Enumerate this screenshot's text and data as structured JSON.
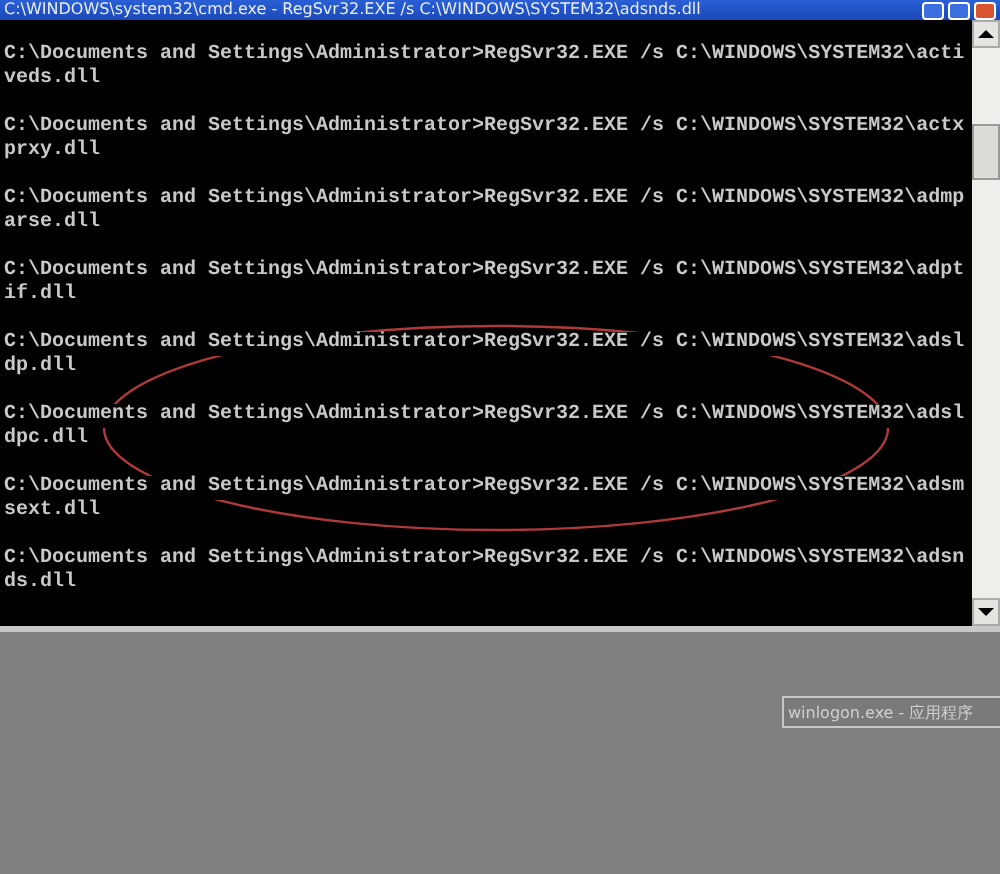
{
  "window": {
    "title": "C:\\WINDOWS\\system32\\cmd.exe - RegSvr32.EXE /s C:\\WINDOWS\\SYSTEM32\\adsnds.dll"
  },
  "console": {
    "entries": [
      {
        "command": "C:\\Documents and Settings\\Administrator>RegSvr32.EXE /s C:\\WINDOWS\\SYSTEM32\\acti",
        "continuation": "veds.dll"
      },
      {
        "command": "C:\\Documents and Settings\\Administrator>RegSvr32.EXE /s C:\\WINDOWS\\SYSTEM32\\actx",
        "continuation": "prxy.dll"
      },
      {
        "command": "C:\\Documents and Settings\\Administrator>RegSvr32.EXE /s C:\\WINDOWS\\SYSTEM32\\admp",
        "continuation": "arse.dll"
      },
      {
        "command": "C:\\Documents and Settings\\Administrator>RegSvr32.EXE /s C:\\WINDOWS\\SYSTEM32\\adpt",
        "continuation": "if.dll"
      },
      {
        "command": "C:\\Documents and Settings\\Administrator>RegSvr32.EXE /s C:\\WINDOWS\\SYSTEM32\\adsl",
        "continuation": "dp.dll"
      },
      {
        "command": "C:\\Documents and Settings\\Administrator>RegSvr32.EXE /s C:\\WINDOWS\\SYSTEM32\\adsl",
        "continuation": "dpc.dll"
      },
      {
        "command": "C:\\Documents and Settings\\Administrator>RegSvr32.EXE /s C:\\WINDOWS\\SYSTEM32\\adsm",
        "continuation": "sext.dll"
      },
      {
        "command": "C:\\Documents and Settings\\Administrator>RegSvr32.EXE /s C:\\WINDOWS\\SYSTEM32\\adsn",
        "continuation": "ds.dll"
      }
    ]
  },
  "annotation": {
    "kind": "ellipse"
  },
  "taskbar_window": {
    "title": "winlogon.exe - 应用程序"
  }
}
